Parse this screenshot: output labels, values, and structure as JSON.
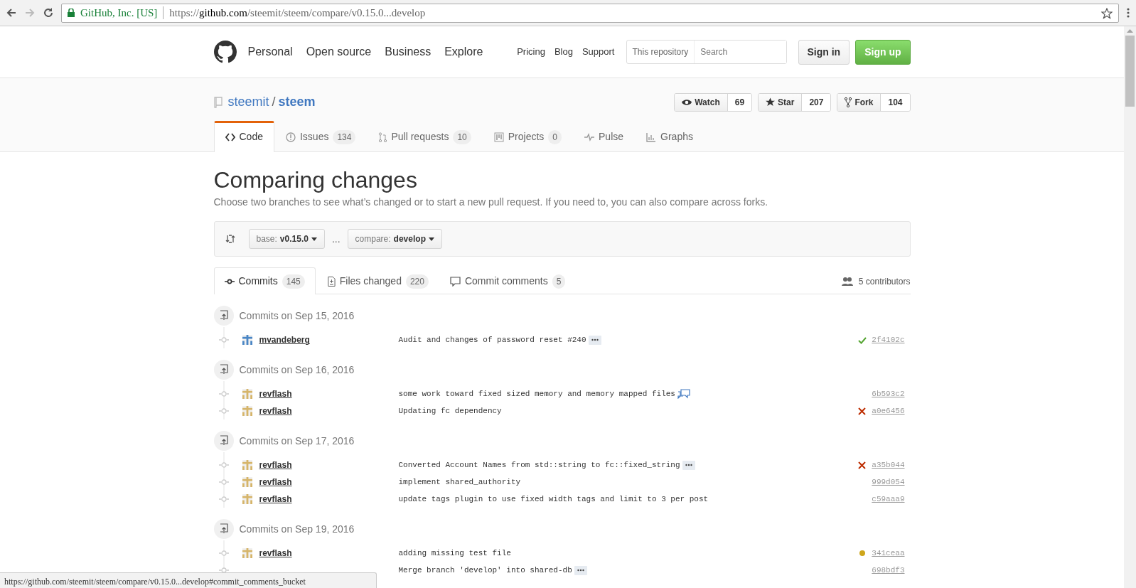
{
  "browser": {
    "security_label": "GitHub, Inc. [US]",
    "url_scheme": "https://",
    "url_host": "github.com",
    "url_path": "/steemit/steem/compare/v0.15.0...develop"
  },
  "header": {
    "nav": [
      "Personal",
      "Open source",
      "Business",
      "Explore"
    ],
    "links": [
      "Pricing",
      "Blog",
      "Support"
    ],
    "search": {
      "scope": "This repository",
      "placeholder": "Search"
    },
    "sign_in": "Sign in",
    "sign_up": "Sign up"
  },
  "repo": {
    "owner": "steemit",
    "separator": "/",
    "name": "steem",
    "actions": [
      {
        "kind": "watch",
        "label": "Watch",
        "count": "69"
      },
      {
        "kind": "star",
        "label": "Star",
        "count": "207"
      },
      {
        "kind": "fork",
        "label": "Fork",
        "count": "104"
      }
    ]
  },
  "tabs": [
    {
      "kind": "code",
      "label": "Code",
      "selected": true
    },
    {
      "kind": "issues",
      "label": "Issues",
      "count": "134",
      "selected": false
    },
    {
      "kind": "pulls",
      "label": "Pull requests",
      "count": "10",
      "selected": false
    },
    {
      "kind": "projects",
      "label": "Projects",
      "count": "0",
      "selected": false
    },
    {
      "kind": "pulse",
      "label": "Pulse",
      "selected": false
    },
    {
      "kind": "graphs",
      "label": "Graphs",
      "selected": false
    }
  ],
  "title": "Comparing changes",
  "subtitle": "Choose two branches to see what’s changed or to start a new pull request. If you need to, you can also",
  "subtitle_link": "compare across forks",
  "subtitle_end": ".",
  "range": {
    "base_label": "base:",
    "base": "v0.15.0",
    "separator": "...",
    "compare_label": "compare:",
    "compare": "develop"
  },
  "compare_tabs": [
    {
      "kind": "commits",
      "label": "Commits",
      "count": "145",
      "selected": true
    },
    {
      "kind": "files",
      "label": "Files changed",
      "count": "220",
      "selected": false
    },
    {
      "kind": "comments",
      "label": "Commit comments",
      "count": "5",
      "selected": false
    }
  ],
  "contributors": "5 contributors",
  "groups": [
    {
      "date": "Commits on Sep 15, 2016",
      "commits": [
        {
          "author": "mvandeberg",
          "color": "#4a86c5",
          "message": "Audit and changes of password reset #240",
          "expandable": true,
          "comments": false,
          "build": {
            "kind": "success"
          },
          "sha": "2f4102c"
        }
      ]
    },
    {
      "date": "Commits on Sep 16, 2016",
      "commits": [
        {
          "author": "revflash",
          "color": "#d6b56a",
          "message": "some work toward fixed sized memory and memory mapped files",
          "expandable": false,
          "comments": true,
          "sha": "6b593c2"
        },
        {
          "author": "revflash",
          "color": "#d6b56a",
          "message": "Updating fc dependency",
          "expandable": false,
          "comments": false,
          "build": {
            "kind": "failure"
          },
          "sha": "a0e6456"
        }
      ]
    },
    {
      "date": "Commits on Sep 17, 2016",
      "commits": [
        {
          "author": "revflash",
          "color": "#d6b56a",
          "message": "Converted Account Names from std::string to fc::fixed_string",
          "expandable": true,
          "comments": false,
          "build": {
            "kind": "failure"
          },
          "sha": "a35b044"
        },
        {
          "author": "revflash",
          "color": "#d6b56a",
          "message": "implement shared_authority",
          "expandable": false,
          "comments": false,
          "sha": "999d054"
        },
        {
          "author": "revflash",
          "color": "#d6b56a",
          "message": "update tags plugin to use fixed width tags and limit to 3 per post",
          "expandable": false,
          "comments": false,
          "sha": "c59aaa9"
        }
      ]
    },
    {
      "date": "Commits on Sep 19, 2016",
      "commits": [
        {
          "author": "revflash",
          "color": "#d6b56a",
          "message": "adding missing test file",
          "expandable": false,
          "comments": false,
          "build": {
            "kind": "pending"
          },
          "sha": "341ceaa"
        },
        {
          "message": "Merge branch 'develop' into shared-db",
          "expandable": true,
          "comments": false,
          "sha": "698bdf3"
        }
      ]
    }
  ],
  "status_bar": "https://github.com/steemit/steem/compare/v0.15.0...develop#commit_comments_bucket"
}
